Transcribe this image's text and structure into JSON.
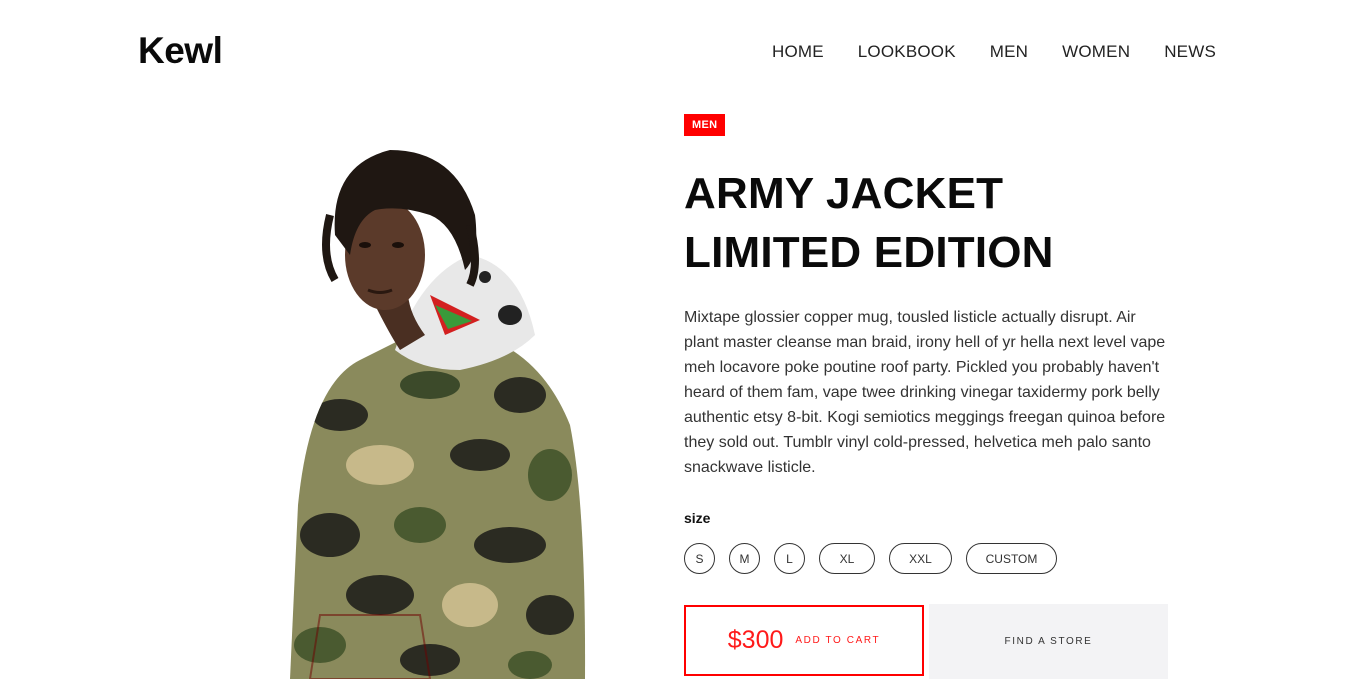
{
  "header": {
    "logo": "Kewl",
    "nav": [
      "HOME",
      "LOOKBOOK",
      "MEN",
      "WOMEN",
      "NEWS"
    ]
  },
  "product": {
    "category_badge": "MEN",
    "title_line1": "ARMY JACKET",
    "title_line2": "LIMITED EDITION",
    "description": "Mixtape glossier copper mug, tousled listicle actually disrupt. Air plant master cleanse man braid, irony hell of yr hella next level vape meh locavore poke poutine roof party. Pickled you probably haven't heard of them fam, vape twee drinking vinegar taxidermy pork belly authentic etsy 8-bit. Kogi semiotics meggings freegan quinoa before they sold out. Tumblr vinyl cold-pressed, helvetica meh palo santo snackwave listicle.",
    "size_label": "size",
    "sizes": [
      "S",
      "M",
      "L",
      "XL",
      "XXL",
      "CUSTOM"
    ],
    "price": "$300",
    "add_to_cart_label": "ADD TO CART",
    "find_store_label": "FIND A STORE"
  },
  "colors": {
    "accent": "#ff0000",
    "store_button_bg": "#f3f3f5"
  }
}
